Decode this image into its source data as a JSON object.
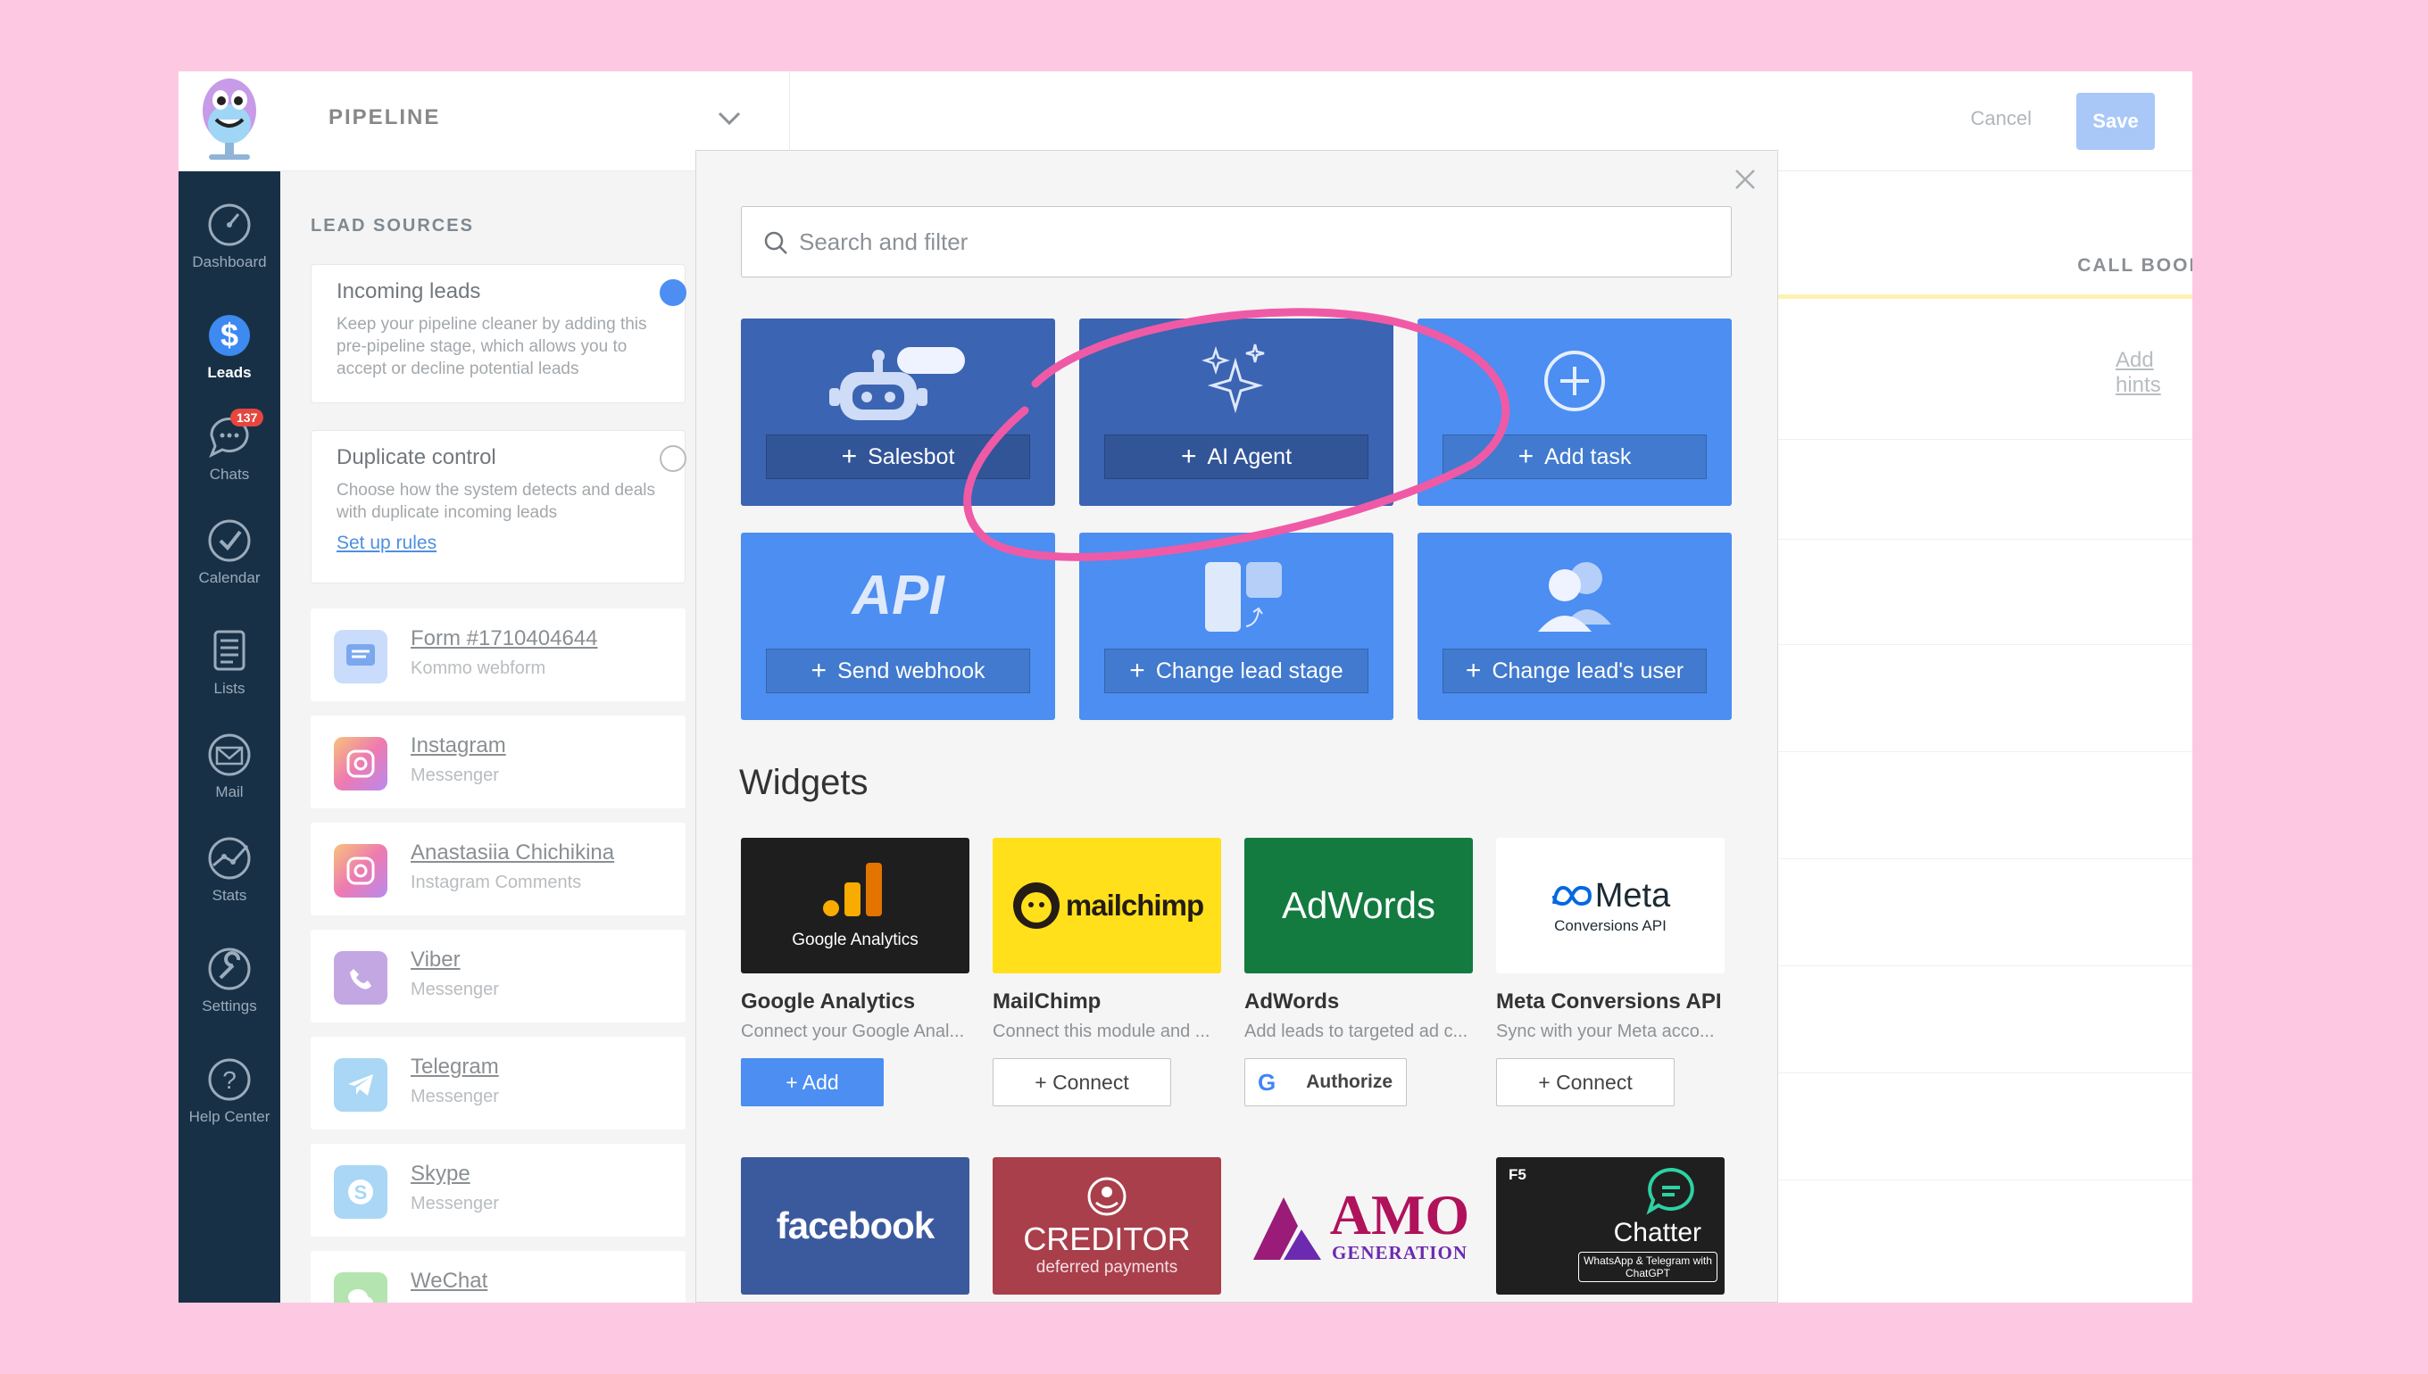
{
  "header": {
    "pipeline_title": "PIPELINE",
    "cancel_label": "Cancel",
    "save_label": "Save"
  },
  "sidebar": {
    "items": [
      {
        "label": "Dashboard",
        "icon": "dashboard-icon"
      },
      {
        "label": "Leads",
        "icon": "leads-icon",
        "active": true
      },
      {
        "label": "Chats",
        "icon": "chats-icon",
        "badge": "137"
      },
      {
        "label": "Calendar",
        "icon": "calendar-icon"
      },
      {
        "label": "Lists",
        "icon": "lists-icon"
      },
      {
        "label": "Mail",
        "icon": "mail-icon"
      },
      {
        "label": "Stats",
        "icon": "stats-icon"
      },
      {
        "label": "Settings",
        "icon": "settings-icon"
      },
      {
        "label": "Help Center",
        "icon": "help-icon"
      }
    ]
  },
  "lead_sources": {
    "title": "LEAD SOURCES",
    "incoming": {
      "title": "Incoming leads",
      "desc": "Keep your pipeline cleaner by adding this pre-pipeline stage, which allows you to accept or decline potential leads"
    },
    "duplicate": {
      "title": "Duplicate control",
      "desc": "Choose how the system detects and deals with duplicate incoming leads",
      "link": "Set up rules"
    },
    "sources": [
      {
        "name": "Form #1710404644",
        "sub": "Kommo webform",
        "icon": "form-icon"
      },
      {
        "name": "Instagram",
        "sub": "Messenger",
        "icon": "instagram-icon"
      },
      {
        "name": "Anastasiia Chichikina",
        "sub": "Instagram Comments",
        "icon": "instagram-icon"
      },
      {
        "name": "Viber",
        "sub": "Messenger",
        "icon": "viber-icon"
      },
      {
        "name": "Telegram",
        "sub": "Messenger",
        "icon": "telegram-icon"
      },
      {
        "name": "Skype",
        "sub": "Messenger",
        "icon": "skype-icon"
      },
      {
        "name": "WeChat",
        "sub": "",
        "icon": "wechat-icon"
      }
    ]
  },
  "stage": {
    "title": "CALL BOOKED",
    "hint": "Add hints"
  },
  "modal": {
    "search_placeholder": "Search and filter",
    "actions": [
      {
        "label": "Salesbot",
        "icon": "robot-icon"
      },
      {
        "label": "AI Agent",
        "icon": "sparkles-icon"
      },
      {
        "label": "Add task",
        "icon": "plus-circle-icon"
      },
      {
        "label": "Send webhook",
        "icon_text": "API"
      },
      {
        "label": "Change lead stage",
        "icon": "stage-icon"
      },
      {
        "label": "Change lead's user",
        "icon": "users-icon"
      }
    ],
    "widgets_title": "Widgets",
    "widgets": [
      {
        "name": "Google Analytics",
        "desc": "Connect your Google Anal...",
        "button": "+ Add",
        "logo_text": "Google Analytics"
      },
      {
        "name": "MailChimp",
        "desc": "Connect this module and ...",
        "button": "+ Connect",
        "logo_text": "mailchimp"
      },
      {
        "name": "AdWords",
        "desc": "Add leads to targeted ad c...",
        "button": "Authorize",
        "logo_text": "AdWords"
      },
      {
        "name": "Meta Conversions API",
        "desc": "Sync with your Meta acco...",
        "button": "+ Connect",
        "logo_text": "Meta",
        "logo_sub": "Conversions API"
      }
    ],
    "widgets_row2": [
      {
        "logo_text": "facebook"
      },
      {
        "logo_text": "CREDITOR",
        "logo_sub": "deferred payments"
      },
      {
        "logo_text": "AMO",
        "logo_sub": "GENERATION"
      },
      {
        "logo_text": "Chatter",
        "logo_sub": "WhatsApp & Telegram with ChatGPT",
        "corner": "F5"
      }
    ]
  },
  "colors": {
    "accent": "#4c8ef2",
    "sidebar": "#183045",
    "background": "#fdc9e2",
    "annotation": "#ef5aa6"
  }
}
